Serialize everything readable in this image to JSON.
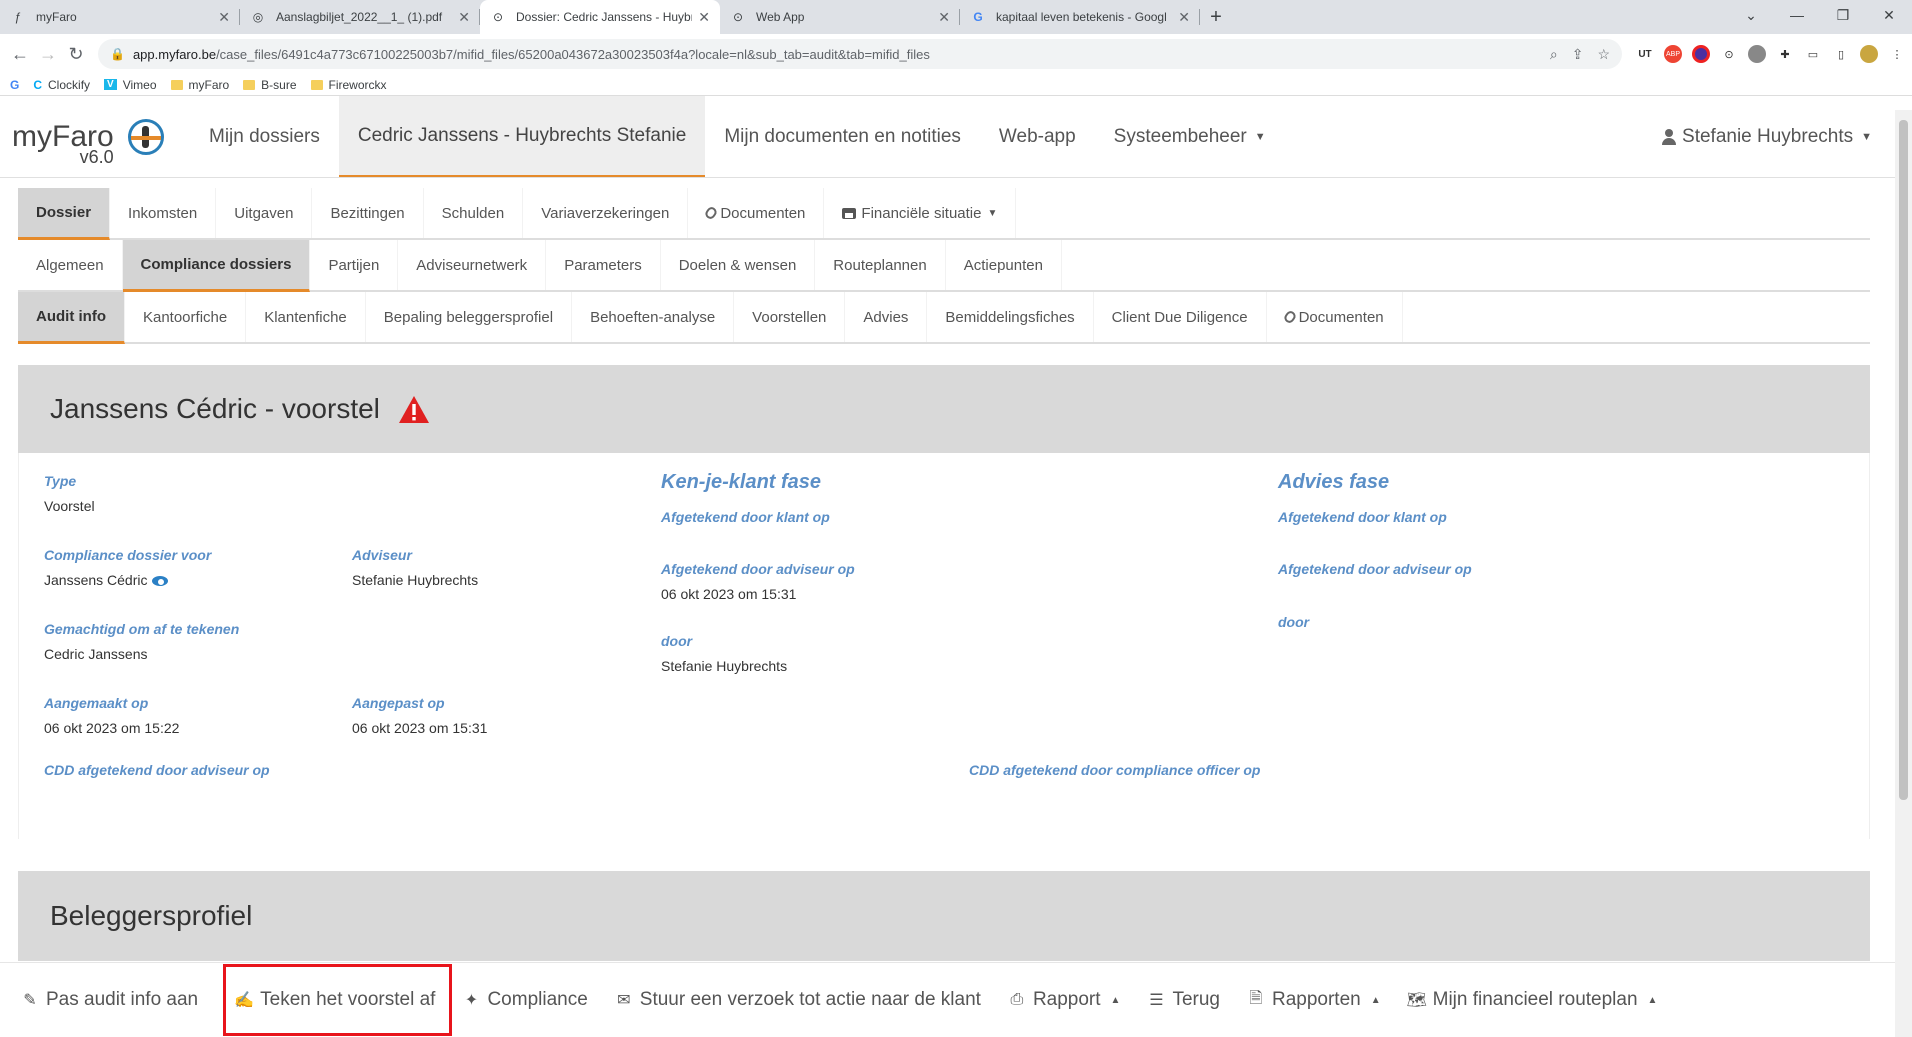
{
  "browser": {
    "tabs": [
      {
        "title": "myFaro",
        "active": false
      },
      {
        "title": "Aanslagbiljet_2022__1_ (1).pdf",
        "active": false
      },
      {
        "title": "Dossier: Cedric Janssens - Huybr",
        "active": true
      },
      {
        "title": "Web App",
        "active": false
      },
      {
        "title": "kapitaal leven betekenis - Googl",
        "active": false
      }
    ],
    "url_host": "app.myfaro.be",
    "url_path": "/case_files/6491c4a773c67100225003b7/mifid_files/65200a043672a30023503f4a?locale=nl&sub_tab=audit&tab=mifid_files",
    "bookmarks": [
      "Clockify",
      "Vimeo",
      "myFaro",
      "B-sure",
      "Fireworckx"
    ]
  },
  "app": {
    "logo": {
      "name": "myFaro",
      "version": "v6.0"
    },
    "nav": [
      "Mijn dossiers",
      "Cedric Janssens - Huybrechts Stefanie",
      "Mijn documenten en notities",
      "Web-app",
      "Systeembeheer"
    ],
    "user": "Stefanie Huybrechts"
  },
  "tabs_level1": [
    "Dossier",
    "Inkomsten",
    "Uitgaven",
    "Bezittingen",
    "Schulden",
    "Variaverzekeringen",
    "Documenten",
    "Financiële situatie"
  ],
  "tabs_level2": [
    "Algemeen",
    "Compliance dossiers",
    "Partijen",
    "Adviseurnetwerk",
    "Parameters",
    "Doelen & wensen",
    "Routeplannen",
    "Actiepunten"
  ],
  "tabs_level3": [
    "Audit info",
    "Kantoorfiche",
    "Klantenfiche",
    "Bepaling beleggersprofiel",
    "Behoeften-analyse",
    "Voorstellen",
    "Advies",
    "Bemiddelingsfiches",
    "Client Due Diligence",
    "Documenten"
  ],
  "audit": {
    "title": "Janssens Cédric - voorstel",
    "type_label": "Type",
    "type_value": "Voorstel",
    "compliance_label": "Compliance dossier voor",
    "compliance_value": "Janssens Cédric",
    "adviseur_label": "Adviseur",
    "adviseur_value": "Stefanie Huybrechts",
    "gemachtigd_label": "Gemachtigd om af te tekenen",
    "gemachtigd_value": "Cedric Janssens",
    "aangemaakt_label": "Aangemaakt op",
    "aangemaakt_value": "06 okt 2023 om 15:22",
    "aangepast_label": "Aangepast op",
    "aangepast_value": "06 okt 2023 om 15:31",
    "cdd_adviseur_label": "CDD afgetekend door adviseur op",
    "cdd_compliance_label": "CDD afgetekend door compliance officer op",
    "kyc": {
      "heading": "Ken-je-klant fase",
      "klant_label": "Afgetekend door klant op",
      "adviseur_label": "Afgetekend door adviseur op",
      "adviseur_value": "06 okt 2023 om 15:31",
      "door_label": "door",
      "door_value": "Stefanie Huybrechts"
    },
    "advies": {
      "heading": "Advies fase",
      "klant_label": "Afgetekend door klant op",
      "adviseur_label": "Afgetekend door adviseur op",
      "door_label": "door"
    }
  },
  "section2_title": "Beleggersprofiel",
  "actions": [
    "Pas audit info aan",
    "Teken het voorstel af",
    "Compliance",
    "Stuur een verzoek tot actie naar de klant",
    "Rapport",
    "Terug",
    "Rapporten",
    "Mijn financieel routeplan"
  ],
  "colors": {
    "accent": "#e58a2a",
    "label_blue": "#5b8fc7",
    "highlight": "#e8141b",
    "warning": "#e02020"
  }
}
